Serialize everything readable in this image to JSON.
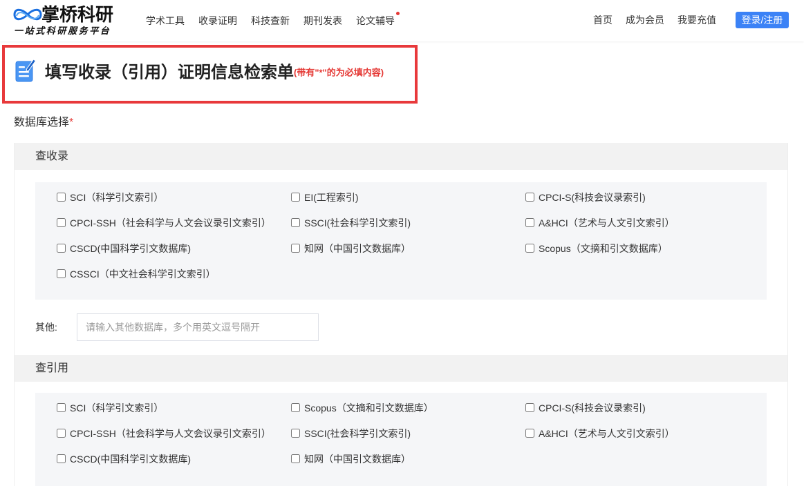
{
  "colors": {
    "brand_blue": "#1a6fe0",
    "login_button_bg": "#3b82f6",
    "highlight_border": "#e8393b",
    "required_red": "#e53935",
    "section_header_bg": "#f2f2f2",
    "options_bg": "#f5f6f8"
  },
  "header": {
    "logo": {
      "icon": "infinity-wave-logo-icon",
      "name": "掌桥科研",
      "slogan": "一站式科研服务平台"
    },
    "nav": [
      {
        "label": "学术工具"
      },
      {
        "label": "收录证明"
      },
      {
        "label": "科技查新"
      },
      {
        "label": "期刊发表"
      },
      {
        "label": "论文辅导",
        "badge": "red-dot"
      }
    ],
    "links": [
      {
        "label": "首页"
      },
      {
        "label": "成为会员"
      },
      {
        "label": "我要充值"
      }
    ],
    "login_button": "登录/注册"
  },
  "form": {
    "title_icon": "edit-document-icon",
    "title": "填写收录（引用）证明信息检索单",
    "title_note": "(带有\"*\"的为必填内容)",
    "database_label": "数据库选择",
    "required_mark": "*",
    "sections": [
      {
        "title": "查收录",
        "options": [
          {
            "label": "SCI（科学引文索引）",
            "checked": false
          },
          {
            "label": "EI(工程索引)",
            "checked": false
          },
          {
            "label": "CPCI-S(科技会议录索引)",
            "checked": false
          },
          {
            "label": "CPCI-SSH（社会科学与人文会议录引文索引）",
            "checked": false
          },
          {
            "label": "SSCI(社会科学引文索引)",
            "checked": false
          },
          {
            "label": "A&HCI（艺术与人文引文索引）",
            "checked": false
          },
          {
            "label": "CSCD(中国科学引文数据库)",
            "checked": false
          },
          {
            "label": "知网（中国引文数据库）",
            "checked": false
          },
          {
            "label": "Scopus（文摘和引文数据库）",
            "checked": false
          },
          {
            "label": "CSSCI（中文社会科学引文索引）",
            "checked": false
          }
        ],
        "other": {
          "label": "其他:",
          "value": "",
          "placeholder": "请输入其他数据库，多个用英文逗号隔开"
        }
      },
      {
        "title": "查引用",
        "options": [
          {
            "label": "SCI（科学引文索引）",
            "checked": false
          },
          {
            "label": "Scopus（文摘和引文数据库）",
            "checked": false
          },
          {
            "label": "CPCI-S(科技会议录索引)",
            "checked": false
          },
          {
            "label": "CPCI-SSH（社会科学与人文会议录引文索引）",
            "checked": false
          },
          {
            "label": "SSCI(社会科学引文索引)",
            "checked": false
          },
          {
            "label": "A&HCI（艺术与人文引文索引）",
            "checked": false
          },
          {
            "label": "CSCD(中国科学引文数据库)",
            "checked": false
          },
          {
            "label": "知网（中国引文数据库）",
            "checked": false
          }
        ]
      }
    ]
  }
}
